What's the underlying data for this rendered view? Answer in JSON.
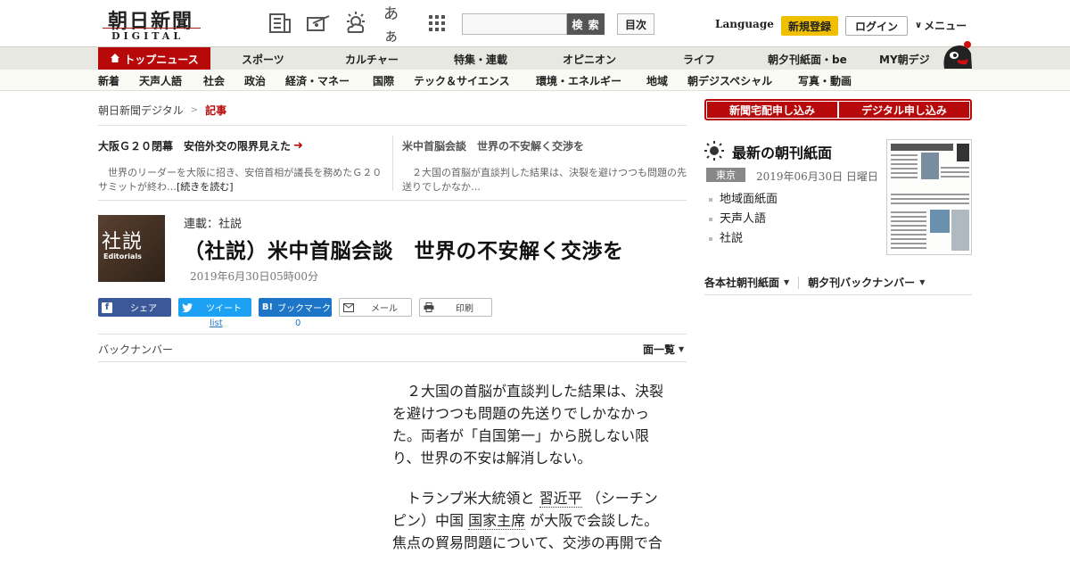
{
  "header": {
    "logo_main": "朝日新聞",
    "logo_sub": "DIGITAL",
    "search_button": "検 索",
    "toc_button": "目次",
    "language_link": "Language",
    "register_button": "新規登録",
    "login_button": "ログイン",
    "menu_button": "メニュー",
    "font_size_icon_text": "あぁ"
  },
  "nav_main": [
    {
      "label": "トップニュース",
      "active": true
    },
    {
      "label": "スポーツ"
    },
    {
      "label": "カルチャー"
    },
    {
      "label": "特集・連載"
    },
    {
      "label": "オピニオン"
    },
    {
      "label": "ライフ"
    },
    {
      "label": "朝夕刊紙面・be"
    },
    {
      "label": "MY朝デジ"
    }
  ],
  "nav_sub": [
    "新着",
    "天声人語",
    "社会",
    "政治",
    "経済・マネー",
    "国際",
    "テック＆サイエンス",
    "環境・エネルギー",
    "地域",
    "朝デジスペシャル",
    "写真・動画"
  ],
  "breadcrumb": {
    "home": "朝日新聞デジタル",
    "separator": ">",
    "current": "記事"
  },
  "related": [
    {
      "title": "大阪Ｇ２０閉幕　安倍外交の限界見えた",
      "text": "世界のリーダーを大阪に招き、安倍首相が議長を務めたＧ２０サミットが終わ…",
      "more": "[続きを読む]"
    },
    {
      "title": "米中首脳会談　世界の不安解く交渉を",
      "text": "２大国の首脳が直談判した結果は、決裂を避けつつも問題の先送りでしかなか…"
    }
  ],
  "article": {
    "thumb_big": "社説",
    "thumb_small": "Editorials",
    "series": "連載：社説",
    "title": "（社説）米中首脳会談　世界の不安解く交渉を",
    "date": "2019年6月30日05時00分"
  },
  "share": {
    "facebook": "シェア",
    "twitter": "ツイート",
    "twitter_count": "list",
    "hatena": "ブックマーク",
    "hatena_icon": "B!",
    "hatena_count": "0",
    "mail": "メール",
    "print": "印刷"
  },
  "backnumber": {
    "label": "バックナンバー",
    "list": "面一覧"
  },
  "body": {
    "p1": "２大国の首脳が直談判した結果は、決裂を避けつつも問題の先送りでしかなかった。両者が「自国第一」から脱しない限り、世界の不安は解消しない。",
    "p2_a": "トランプ米大統領と",
    "p2_term1": "習近平",
    "p2_b": "（シーチンピン）中国",
    "p2_term2": "国家主席",
    "p2_c": "が大阪で会談した。焦点の貿易問題について、交渉の再開で合"
  },
  "sidebar": {
    "subscribe_home": "新聞宅配申し込み",
    "subscribe_digital": "デジタル申し込み",
    "latest_title": "最新の朝刊紙面",
    "region": "東京",
    "date": "2019年06月30日 日曜日",
    "list": [
      "地域面紙面",
      "天声人語",
      "社説"
    ],
    "link_all": "各本社朝刊紙面",
    "link_back": "朝夕刊バックナンバー"
  },
  "colors": {
    "brand_red": "#b8090a",
    "register_yellow": "#f0c000",
    "facebook": "#3b5998",
    "twitter": "#1da1f2",
    "hatena": "#1d75c8"
  }
}
